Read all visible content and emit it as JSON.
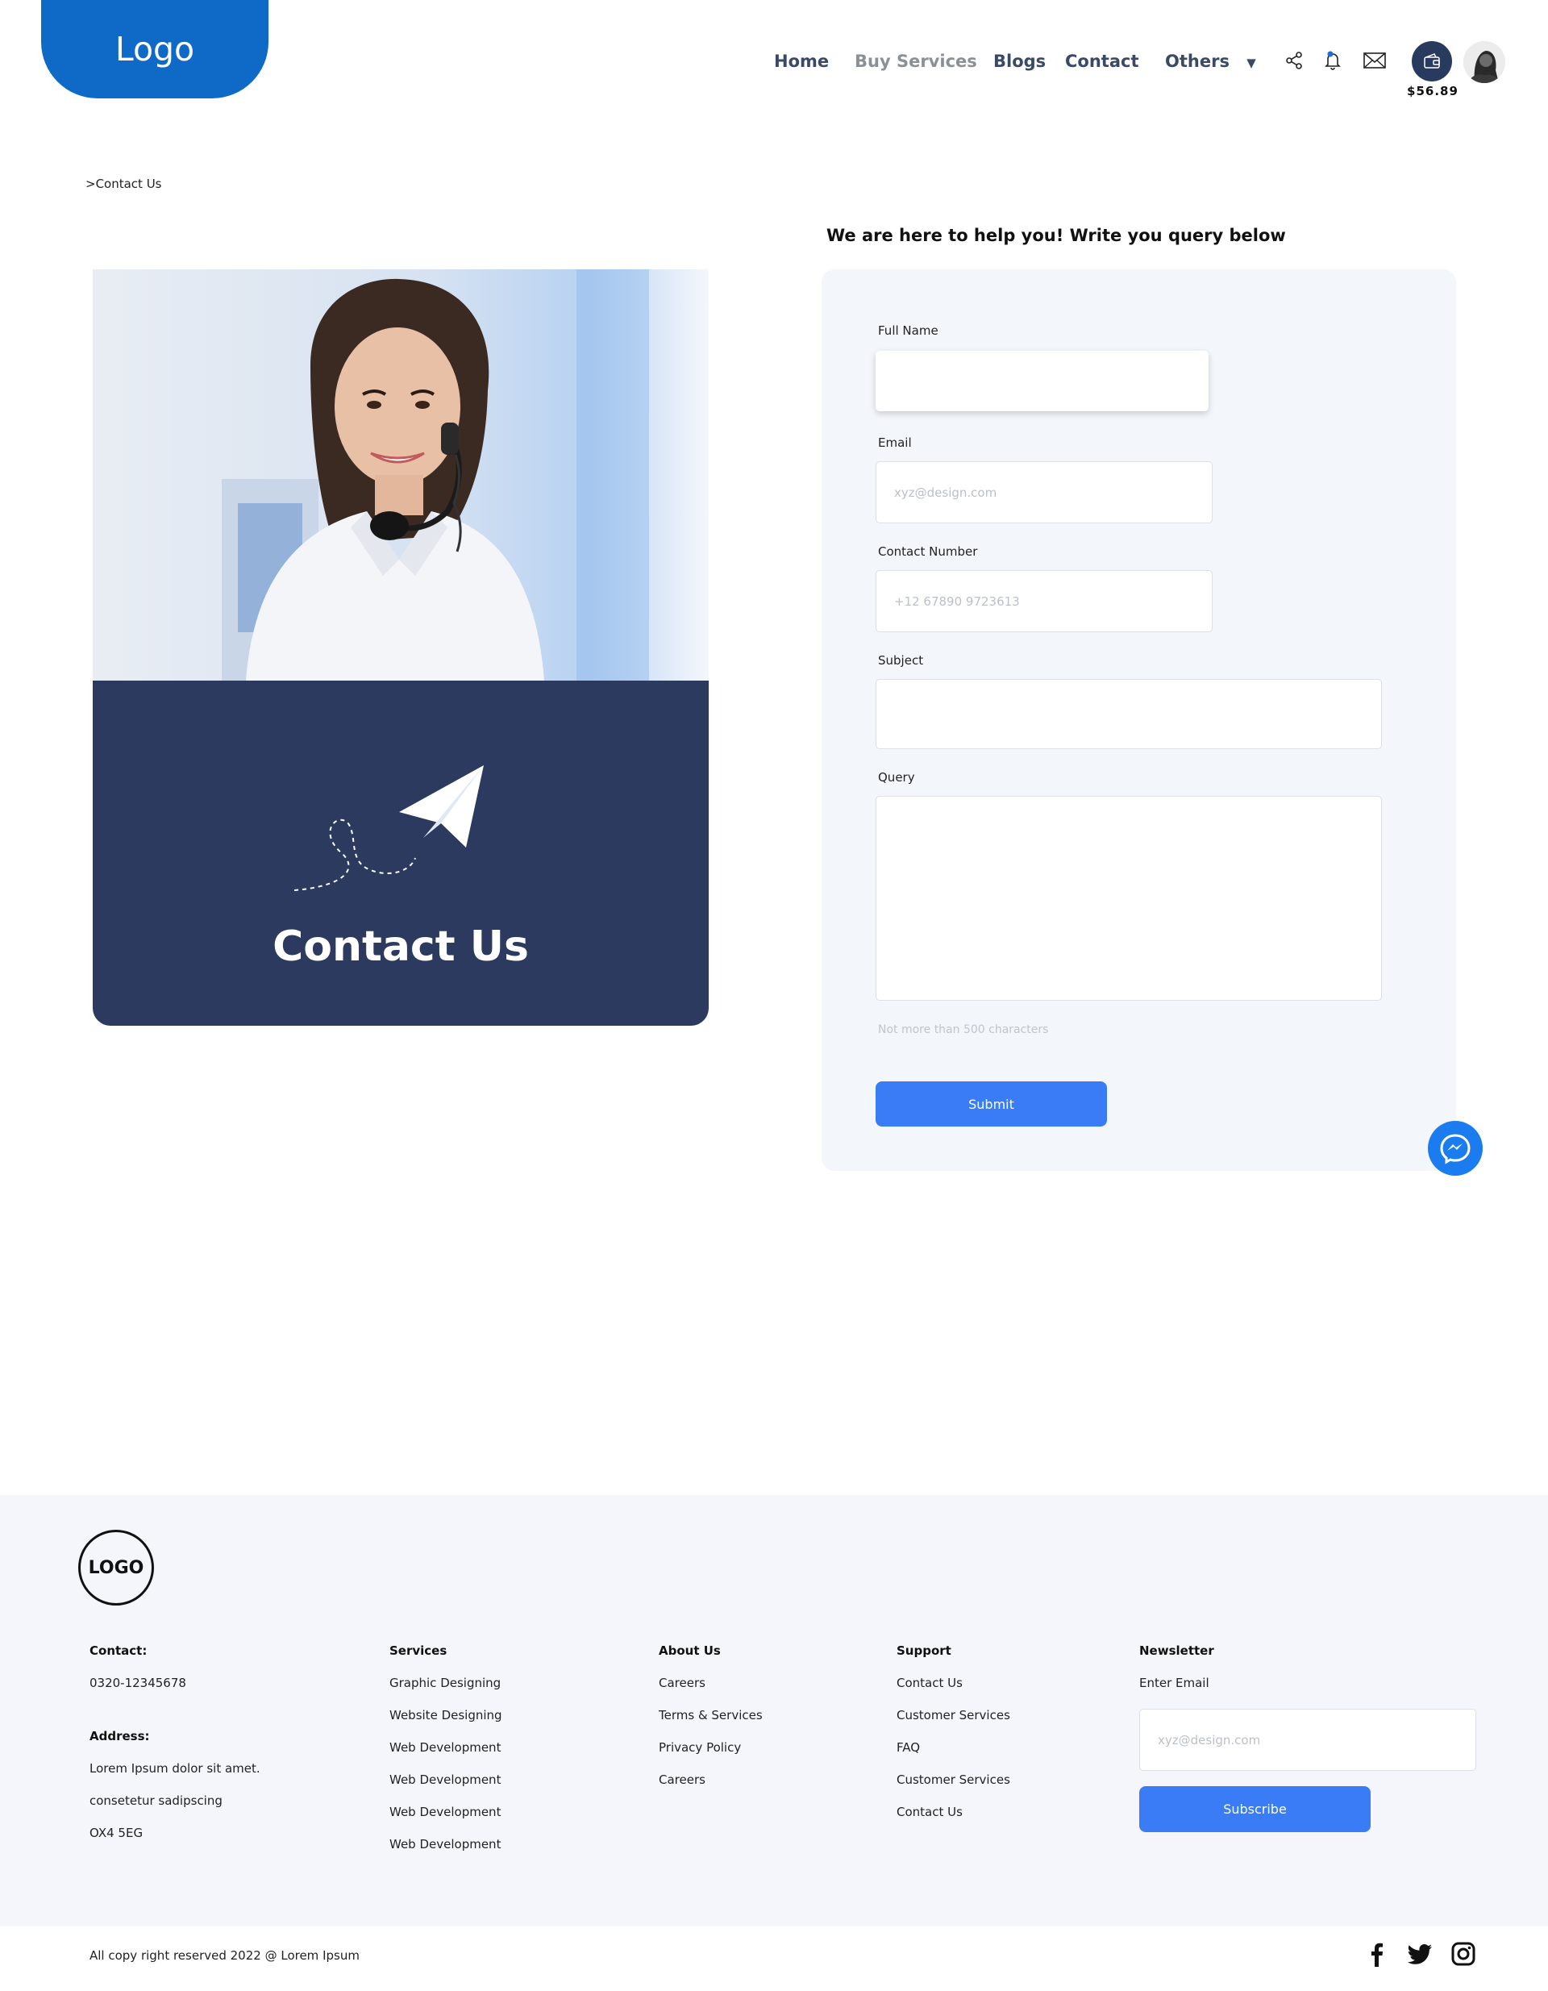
{
  "header": {
    "logo": "Logo",
    "nav": [
      "Home",
      "Buy Services",
      "Blogs",
      "Contact",
      "Others"
    ],
    "wallet_amount": "$56.89"
  },
  "breadcrumb": ">Contact Us",
  "hero_card": {
    "title": "Contact Us"
  },
  "form": {
    "heading": "We are here to help you! Write you query below",
    "full_name_label": "Full Name",
    "email_label": "Email",
    "email_placeholder": "xyz@design.com",
    "contact_label": "Contact Number",
    "contact_placeholder": "+12 67890 9723613",
    "subject_label": "Subject",
    "query_label": "Query",
    "query_hint": "Not more than 500 characters",
    "submit": "Submit"
  },
  "footer": {
    "logo": "LOGO",
    "contact": {
      "heading": "Contact:",
      "phone": "0320-12345678",
      "address_heading": "Address:",
      "address_lines": [
        "Lorem Ipsum dolor sit amet.",
        "consetetur sadipscing",
        "OX4 5EG"
      ]
    },
    "services": {
      "heading": "Services",
      "items": [
        "Graphic Designing",
        "Website Designing",
        "Web Development",
        "Web Development",
        "Web Development",
        "Web Development"
      ]
    },
    "about": {
      "heading": "About Us",
      "items": [
        "Careers",
        "Terms & Services",
        "Privacy Policy",
        "Careers"
      ]
    },
    "support": {
      "heading": "Support",
      "items": [
        "Contact Us",
        "Customer Services",
        "FAQ",
        "Customer Services",
        "Contact Us"
      ]
    },
    "newsletter": {
      "heading": "Newsletter",
      "label": "Enter Email",
      "placeholder": "xyz@design.com",
      "button": "Subscribe"
    },
    "copyright": "All copy right reserved 2022 @ Lorem Ipsum"
  },
  "colors": {
    "brand": "#0e6ac6",
    "card": "#2b3a5e",
    "button": "#3a7cf5"
  }
}
